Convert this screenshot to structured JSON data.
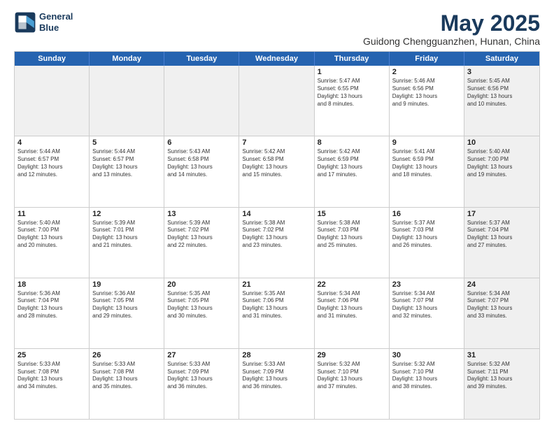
{
  "logo": {
    "line1": "General",
    "line2": "Blue"
  },
  "title": "May 2025",
  "subtitle": "Guidong Chengguanzhen, Hunan, China",
  "header_days": [
    "Sunday",
    "Monday",
    "Tuesday",
    "Wednesday",
    "Thursday",
    "Friday",
    "Saturday"
  ],
  "weeks": [
    [
      {
        "day": "",
        "info": "",
        "shaded": true
      },
      {
        "day": "",
        "info": "",
        "shaded": true
      },
      {
        "day": "",
        "info": "",
        "shaded": true
      },
      {
        "day": "",
        "info": "",
        "shaded": true
      },
      {
        "day": "1",
        "info": "Sunrise: 5:47 AM\nSunset: 6:55 PM\nDaylight: 13 hours\nand 8 minutes.",
        "shaded": false
      },
      {
        "day": "2",
        "info": "Sunrise: 5:46 AM\nSunset: 6:56 PM\nDaylight: 13 hours\nand 9 minutes.",
        "shaded": false
      },
      {
        "day": "3",
        "info": "Sunrise: 5:45 AM\nSunset: 6:56 PM\nDaylight: 13 hours\nand 10 minutes.",
        "shaded": true
      }
    ],
    [
      {
        "day": "4",
        "info": "Sunrise: 5:44 AM\nSunset: 6:57 PM\nDaylight: 13 hours\nand 12 minutes.",
        "shaded": false
      },
      {
        "day": "5",
        "info": "Sunrise: 5:44 AM\nSunset: 6:57 PM\nDaylight: 13 hours\nand 13 minutes.",
        "shaded": false
      },
      {
        "day": "6",
        "info": "Sunrise: 5:43 AM\nSunset: 6:58 PM\nDaylight: 13 hours\nand 14 minutes.",
        "shaded": false
      },
      {
        "day": "7",
        "info": "Sunrise: 5:42 AM\nSunset: 6:58 PM\nDaylight: 13 hours\nand 15 minutes.",
        "shaded": false
      },
      {
        "day": "8",
        "info": "Sunrise: 5:42 AM\nSunset: 6:59 PM\nDaylight: 13 hours\nand 17 minutes.",
        "shaded": false
      },
      {
        "day": "9",
        "info": "Sunrise: 5:41 AM\nSunset: 6:59 PM\nDaylight: 13 hours\nand 18 minutes.",
        "shaded": false
      },
      {
        "day": "10",
        "info": "Sunrise: 5:40 AM\nSunset: 7:00 PM\nDaylight: 13 hours\nand 19 minutes.",
        "shaded": true
      }
    ],
    [
      {
        "day": "11",
        "info": "Sunrise: 5:40 AM\nSunset: 7:00 PM\nDaylight: 13 hours\nand 20 minutes.",
        "shaded": false
      },
      {
        "day": "12",
        "info": "Sunrise: 5:39 AM\nSunset: 7:01 PM\nDaylight: 13 hours\nand 21 minutes.",
        "shaded": false
      },
      {
        "day": "13",
        "info": "Sunrise: 5:39 AM\nSunset: 7:02 PM\nDaylight: 13 hours\nand 22 minutes.",
        "shaded": false
      },
      {
        "day": "14",
        "info": "Sunrise: 5:38 AM\nSunset: 7:02 PM\nDaylight: 13 hours\nand 23 minutes.",
        "shaded": false
      },
      {
        "day": "15",
        "info": "Sunrise: 5:38 AM\nSunset: 7:03 PM\nDaylight: 13 hours\nand 25 minutes.",
        "shaded": false
      },
      {
        "day": "16",
        "info": "Sunrise: 5:37 AM\nSunset: 7:03 PM\nDaylight: 13 hours\nand 26 minutes.",
        "shaded": false
      },
      {
        "day": "17",
        "info": "Sunrise: 5:37 AM\nSunset: 7:04 PM\nDaylight: 13 hours\nand 27 minutes.",
        "shaded": true
      }
    ],
    [
      {
        "day": "18",
        "info": "Sunrise: 5:36 AM\nSunset: 7:04 PM\nDaylight: 13 hours\nand 28 minutes.",
        "shaded": false
      },
      {
        "day": "19",
        "info": "Sunrise: 5:36 AM\nSunset: 7:05 PM\nDaylight: 13 hours\nand 29 minutes.",
        "shaded": false
      },
      {
        "day": "20",
        "info": "Sunrise: 5:35 AM\nSunset: 7:05 PM\nDaylight: 13 hours\nand 30 minutes.",
        "shaded": false
      },
      {
        "day": "21",
        "info": "Sunrise: 5:35 AM\nSunset: 7:06 PM\nDaylight: 13 hours\nand 31 minutes.",
        "shaded": false
      },
      {
        "day": "22",
        "info": "Sunrise: 5:34 AM\nSunset: 7:06 PM\nDaylight: 13 hours\nand 31 minutes.",
        "shaded": false
      },
      {
        "day": "23",
        "info": "Sunrise: 5:34 AM\nSunset: 7:07 PM\nDaylight: 13 hours\nand 32 minutes.",
        "shaded": false
      },
      {
        "day": "24",
        "info": "Sunrise: 5:34 AM\nSunset: 7:07 PM\nDaylight: 13 hours\nand 33 minutes.",
        "shaded": true
      }
    ],
    [
      {
        "day": "25",
        "info": "Sunrise: 5:33 AM\nSunset: 7:08 PM\nDaylight: 13 hours\nand 34 minutes.",
        "shaded": false
      },
      {
        "day": "26",
        "info": "Sunrise: 5:33 AM\nSunset: 7:08 PM\nDaylight: 13 hours\nand 35 minutes.",
        "shaded": false
      },
      {
        "day": "27",
        "info": "Sunrise: 5:33 AM\nSunset: 7:09 PM\nDaylight: 13 hours\nand 36 minutes.",
        "shaded": false
      },
      {
        "day": "28",
        "info": "Sunrise: 5:33 AM\nSunset: 7:09 PM\nDaylight: 13 hours\nand 36 minutes.",
        "shaded": false
      },
      {
        "day": "29",
        "info": "Sunrise: 5:32 AM\nSunset: 7:10 PM\nDaylight: 13 hours\nand 37 minutes.",
        "shaded": false
      },
      {
        "day": "30",
        "info": "Sunrise: 5:32 AM\nSunset: 7:10 PM\nDaylight: 13 hours\nand 38 minutes.",
        "shaded": false
      },
      {
        "day": "31",
        "info": "Sunrise: 5:32 AM\nSunset: 7:11 PM\nDaylight: 13 hours\nand 39 minutes.",
        "shaded": true
      }
    ]
  ]
}
